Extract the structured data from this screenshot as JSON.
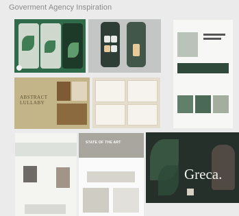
{
  "board": {
    "title": "Goverment Agency Inspiration"
  },
  "cards": {
    "abstract": {
      "line1": "ABSTRACT",
      "line2": "LULLABY"
    },
    "state_of_art": {
      "headline": "STATE OF THE ART"
    },
    "greca": {
      "headline": "Greca."
    }
  }
}
